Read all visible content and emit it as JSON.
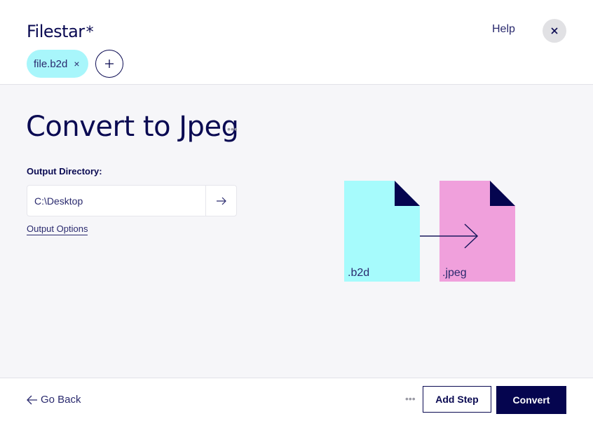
{
  "app": {
    "logo": "Filestar",
    "logo_mark": "*",
    "help_label": "Help",
    "close_icon": "close-icon"
  },
  "files": [
    {
      "name": "file.b2d",
      "remove_icon": "×"
    }
  ],
  "add_file_icon": "+",
  "main": {
    "title": "Convert to Jpeg",
    "more_icon": "•••",
    "output_directory_label": "Output Directory:",
    "output_directory_value": "C:\\Desktop",
    "output_options_label": "Output Options"
  },
  "illustration": {
    "source_ext": ".b2d",
    "target_ext": ".jpeg",
    "source_color": "#a6fbfc",
    "target_color": "#f0a0dc",
    "corner_color": "#05054f"
  },
  "footer": {
    "back_label": "Go Back",
    "more_icon": "•••",
    "add_step_label": "Add Step",
    "convert_label": "Convert"
  }
}
